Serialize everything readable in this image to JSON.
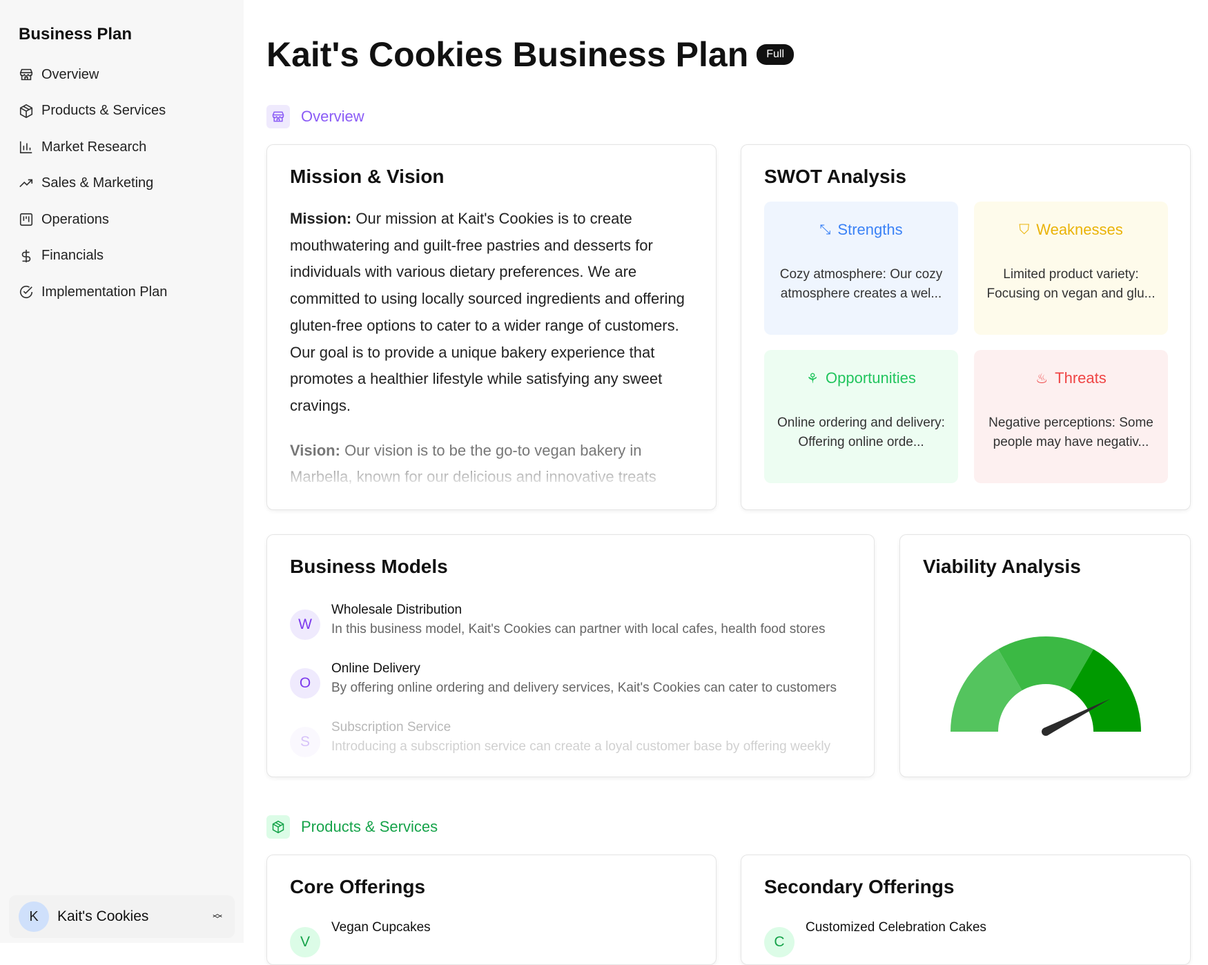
{
  "sidebar": {
    "title": "Business Plan",
    "items": [
      {
        "label": "Overview",
        "icon": "store-icon"
      },
      {
        "label": "Products & Services",
        "icon": "package-icon"
      },
      {
        "label": "Market Research",
        "icon": "bar-chart-icon"
      },
      {
        "label": "Sales & Marketing",
        "icon": "trending-up-icon"
      },
      {
        "label": "Operations",
        "icon": "kanban-icon"
      },
      {
        "label": "Financials",
        "icon": "dollar-icon"
      },
      {
        "label": "Implementation Plan",
        "icon": "check-circle-icon"
      }
    ],
    "account": {
      "initial": "K",
      "name": "Kait's Cookies"
    }
  },
  "header": {
    "title": "Kait's Cookies Business Plan",
    "badge": "Full"
  },
  "sections": {
    "overview": "Overview",
    "products": "Products & Services"
  },
  "mission_card": {
    "title": "Mission & Vision",
    "mission_label": "Mission:",
    "mission": "Our mission at Kait's Cookies is to create mouthwatering and guilt-free pastries and desserts for individuals with various dietary preferences. We are committed to using locally sourced ingredients and offering gluten-free options to cater to a wider range of customers. Our goal is to provide a unique bakery experience that promotes a healthier lifestyle while satisfying any sweet cravings.",
    "vision_label": "Vision:",
    "vision": "Our vision is to be the go-to vegan bakery in Marbella, known for our delicious and innovative treats"
  },
  "swot": {
    "title": "SWOT Analysis",
    "strengths": {
      "label": "Strengths",
      "text": "Cozy atmosphere: Our cozy atmosphere creates a wel...",
      "color": "#3b82f6"
    },
    "weaknesses": {
      "label": "Weaknesses",
      "text": "Limited product variety: Focusing on vegan and glu...",
      "color": "#eab308"
    },
    "opportunities": {
      "label": "Opportunities",
      "text": "Online ordering and delivery: Offering online orde...",
      "color": "#22c55e"
    },
    "threats": {
      "label": "Threats",
      "text": "Negative perceptions: Some people may have negativ...",
      "color": "#ef4444"
    }
  },
  "business_models": {
    "title": "Business Models",
    "items": [
      {
        "initial": "W",
        "name": "Wholesale Distribution",
        "desc": "In this business model, Kait's Cookies can partner with local cafes, health food stores"
      },
      {
        "initial": "O",
        "name": "Online Delivery",
        "desc": "By offering online ordering and delivery services, Kait's Cookies can cater to customers"
      },
      {
        "initial": "S",
        "name": "Subscription Service",
        "desc": "Introducing a subscription service can create a loyal customer base by offering weekly"
      }
    ]
  },
  "viability": {
    "title": "Viability Analysis",
    "gauge_value": 0.85,
    "segment_colors": [
      "#54c45e",
      "#3bb944",
      "#009a00"
    ]
  },
  "core": {
    "title": "Core Offerings",
    "items": [
      {
        "initial": "V",
        "name": "Vegan Cupcakes"
      }
    ]
  },
  "secondary": {
    "title": "Secondary Offerings",
    "items": [
      {
        "initial": "C",
        "name": "Customized Celebration Cakes"
      }
    ]
  }
}
